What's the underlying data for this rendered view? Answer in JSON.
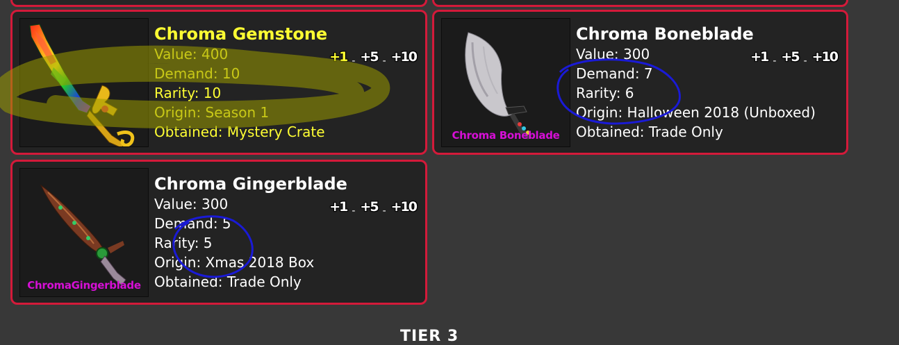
{
  "items": [
    {
      "name": "Chroma Gemstone",
      "value": "Value: 400",
      "demand": "Demand: 10",
      "rarity": "Rarity: 10",
      "origin": "Origin: Season 1",
      "obtained": "Obtained: Mystery Crate",
      "caption": "",
      "highlight_color": "#ffff33",
      "buttons": [
        "+1",
        "+5",
        "+10"
      ],
      "active_button": "+1"
    },
    {
      "name": "Chroma Boneblade",
      "value": "Value: 300",
      "demand": "Demand: 7",
      "rarity": "Rarity: 6",
      "origin": "Origin: Halloween 2018 (Unboxed)",
      "obtained": "Obtained: Trade Only",
      "caption": "Chroma Boneblade",
      "buttons": [
        "+1",
        "+5",
        "+10"
      ]
    },
    {
      "name": "Chroma Gingerblade",
      "value": "Value: 300",
      "demand": "Demand: 5",
      "rarity": "Rarity: 5",
      "origin": "Origin: Xmas 2018 Box",
      "obtained": "Obtained: Trade Only",
      "caption": "ChromaGingerblade",
      "buttons": [
        "+1",
        "+5",
        "+10"
      ]
    }
  ],
  "separator": "-",
  "section_heading": "TIER 3",
  "colors": {
    "background": "#383838",
    "card_background": "#232323",
    "card_border": "#d41a3a",
    "caption": "#d60fd6",
    "annotation_circle": "#1a1ad6",
    "scribble": "#9a9a00"
  }
}
